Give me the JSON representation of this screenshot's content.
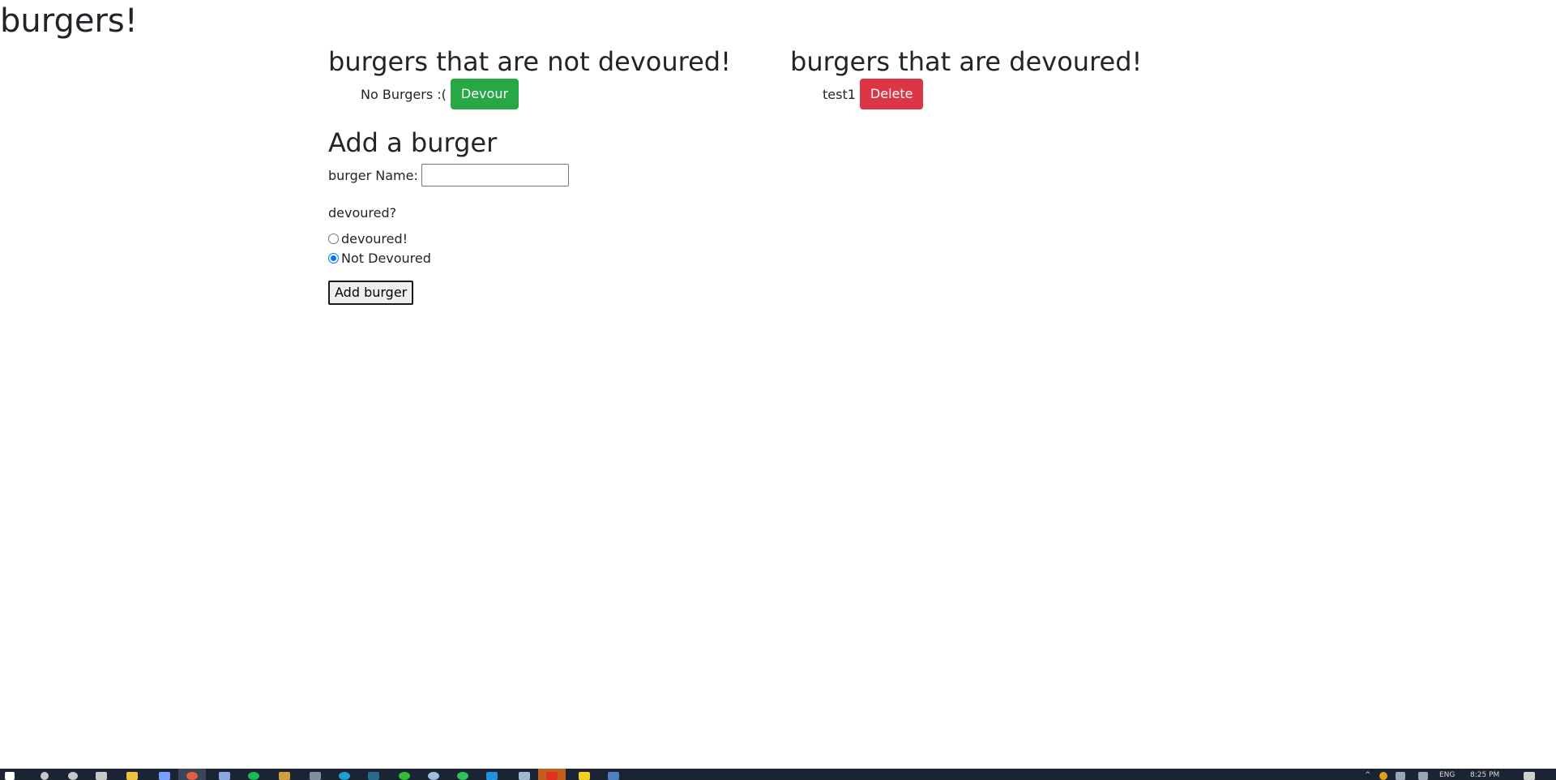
{
  "page": {
    "title": "burgers!"
  },
  "not_devoured": {
    "heading": "burgers that are not devoured!",
    "items": [
      {
        "name": "No Burgers :(",
        "button_label": "Devour"
      }
    ]
  },
  "devoured": {
    "heading": "burgers that are devoured!",
    "items": [
      {
        "name": "test1",
        "button_label": "Delete"
      }
    ]
  },
  "add_form": {
    "heading": "Add a burger",
    "name_label": "burger Name:",
    "name_value": "",
    "question": "devoured?",
    "options": [
      {
        "label": "devoured!",
        "checked": false
      },
      {
        "label": "Not Devoured",
        "checked": true
      }
    ],
    "submit_label": "Add burger"
  },
  "taskbar": {
    "language": "ENG",
    "clock": "8:25 PM",
    "icons": [
      "start-icon",
      "search-icon",
      "cortana-icon",
      "task-view-icon",
      "file-explorer-icon",
      "app-icon",
      "chrome-icon",
      "app-icon",
      "spotify-icon",
      "app-icon",
      "app-icon",
      "app-icon",
      "app-icon",
      "app-icon",
      "app-icon",
      "app-icon",
      "vscode-icon",
      "app-icon",
      "app-icon",
      "app-icon",
      "app-icon"
    ],
    "colors": {
      "bar": "#1b2433",
      "success": "#28a745",
      "danger": "#dc3545"
    }
  }
}
